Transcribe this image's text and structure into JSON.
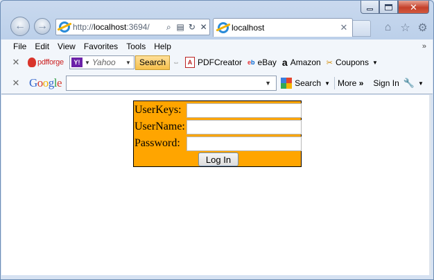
{
  "window": {
    "url_prefix": "http://",
    "url_host": "localhost",
    "url_rest": ":3694/",
    "tab_title": "localhost"
  },
  "menu": [
    "File",
    "Edit",
    "View",
    "Favorites",
    "Tools",
    "Help"
  ],
  "toolbar1": {
    "pdfforge": "pdfforge",
    "yahoo_placeholder": "Yahoo",
    "search_label": "Search",
    "pdfcreator": "PDFCreator",
    "ebay": "eBay",
    "amazon": "Amazon",
    "coupons": "Coupons"
  },
  "toolbar2": {
    "google_search": "Search",
    "more": "More",
    "sign_in": "Sign In"
  },
  "login": {
    "userkeys_label": "UserKeys:",
    "username_label": "UserName:",
    "password_label": "Password:",
    "login_button": "Log In"
  },
  "colors": {
    "login_background": "#ffa500",
    "search_button": "#f6c04c"
  }
}
